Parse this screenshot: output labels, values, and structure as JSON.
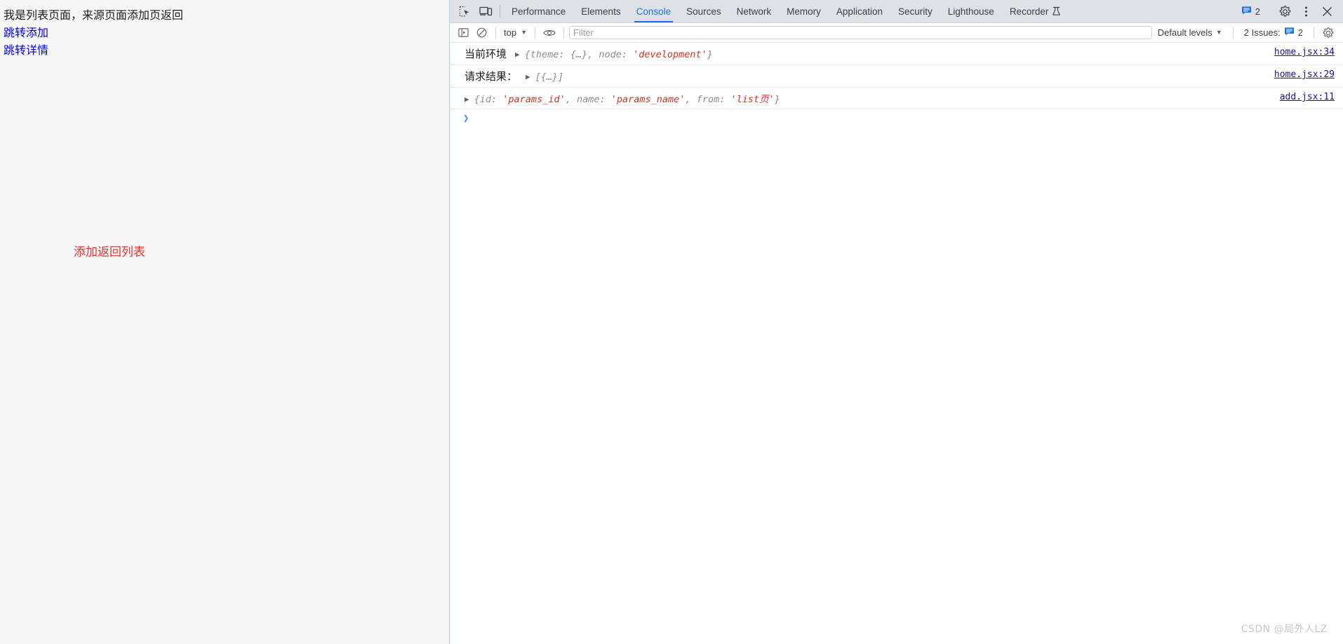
{
  "page": {
    "heading": "我是列表页面，来源页面添加页返回",
    "links": [
      {
        "label": "跳转添加",
        "name": "link-jump-add"
      },
      {
        "label": "跳转详情",
        "name": "link-jump-detail"
      }
    ],
    "note": "添加返回列表",
    "note_color": "#f0302f",
    "link_color": "#0000ee",
    "background": "#f7f7f7"
  },
  "devtools": {
    "accent_color": "#1a73e8",
    "tabbar": {
      "inspect_icon": "inspect-element-icon",
      "device_icon": "device-toolbar-icon",
      "tabs": [
        {
          "label": "Performance",
          "active": false
        },
        {
          "label": "Elements",
          "active": false
        },
        {
          "label": "Console",
          "active": true
        },
        {
          "label": "Sources",
          "active": false
        },
        {
          "label": "Network",
          "active": false
        },
        {
          "label": "Memory",
          "active": false
        },
        {
          "label": "Application",
          "active": false
        },
        {
          "label": "Security",
          "active": false
        },
        {
          "label": "Lighthouse",
          "active": false
        },
        {
          "label": "Recorder",
          "active": false,
          "badge_icon": "flask-icon"
        }
      ],
      "issues_count": "2",
      "settings_icon": "gear-icon",
      "more_icon": "kebab-menu-icon",
      "close_icon": "close-icon"
    },
    "console_toolbar": {
      "sidebar_icon": "console-sidebar-icon",
      "clear_icon": "clear-console-icon",
      "context": "top",
      "eye_icon": "live-expression-eye-icon",
      "filter_placeholder": "Filter",
      "filter_value": "",
      "levels_label": "Default levels",
      "issues_label": "2 Issues:",
      "issues_count": "2",
      "settings_icon": "console-settings-gear-icon"
    },
    "logs": [
      {
        "label": "当前环境",
        "disclosure": "▶",
        "parts": [
          {
            "t": "{",
            "c": "brace"
          },
          {
            "t": "theme",
            "c": "k"
          },
          {
            "t": ": ",
            "c": "k"
          },
          {
            "t": "{…}",
            "c": "brace"
          },
          {
            "t": ", ",
            "c": "k"
          },
          {
            "t": "node",
            "c": "k"
          },
          {
            "t": ": ",
            "c": "k"
          },
          {
            "t": "'development'",
            "c": "s"
          },
          {
            "t": "}",
            "c": "brace"
          }
        ],
        "source": "home.jsx:34"
      },
      {
        "label": "请求结果：",
        "disclosure": "▶",
        "parts": [
          {
            "t": "[{…}]",
            "c": "brace"
          }
        ],
        "source": "home.jsx:29"
      },
      {
        "label": "",
        "disclosure": "▶",
        "parts": [
          {
            "t": "{",
            "c": "brace"
          },
          {
            "t": "id",
            "c": "k"
          },
          {
            "t": ": ",
            "c": "k"
          },
          {
            "t": "'params_id'",
            "c": "s"
          },
          {
            "t": ", ",
            "c": "k"
          },
          {
            "t": "name",
            "c": "k"
          },
          {
            "t": ": ",
            "c": "k"
          },
          {
            "t": "'params_name'",
            "c": "s"
          },
          {
            "t": ", ",
            "c": "k"
          },
          {
            "t": "from",
            "c": "k"
          },
          {
            "t": ": ",
            "c": "k"
          },
          {
            "t": "'list页'",
            "c": "s"
          },
          {
            "t": "}",
            "c": "brace"
          }
        ],
        "source": "add.jsx:11"
      }
    ],
    "prompt_caret": "❯"
  },
  "watermark": "CSDN @局外人LZ"
}
